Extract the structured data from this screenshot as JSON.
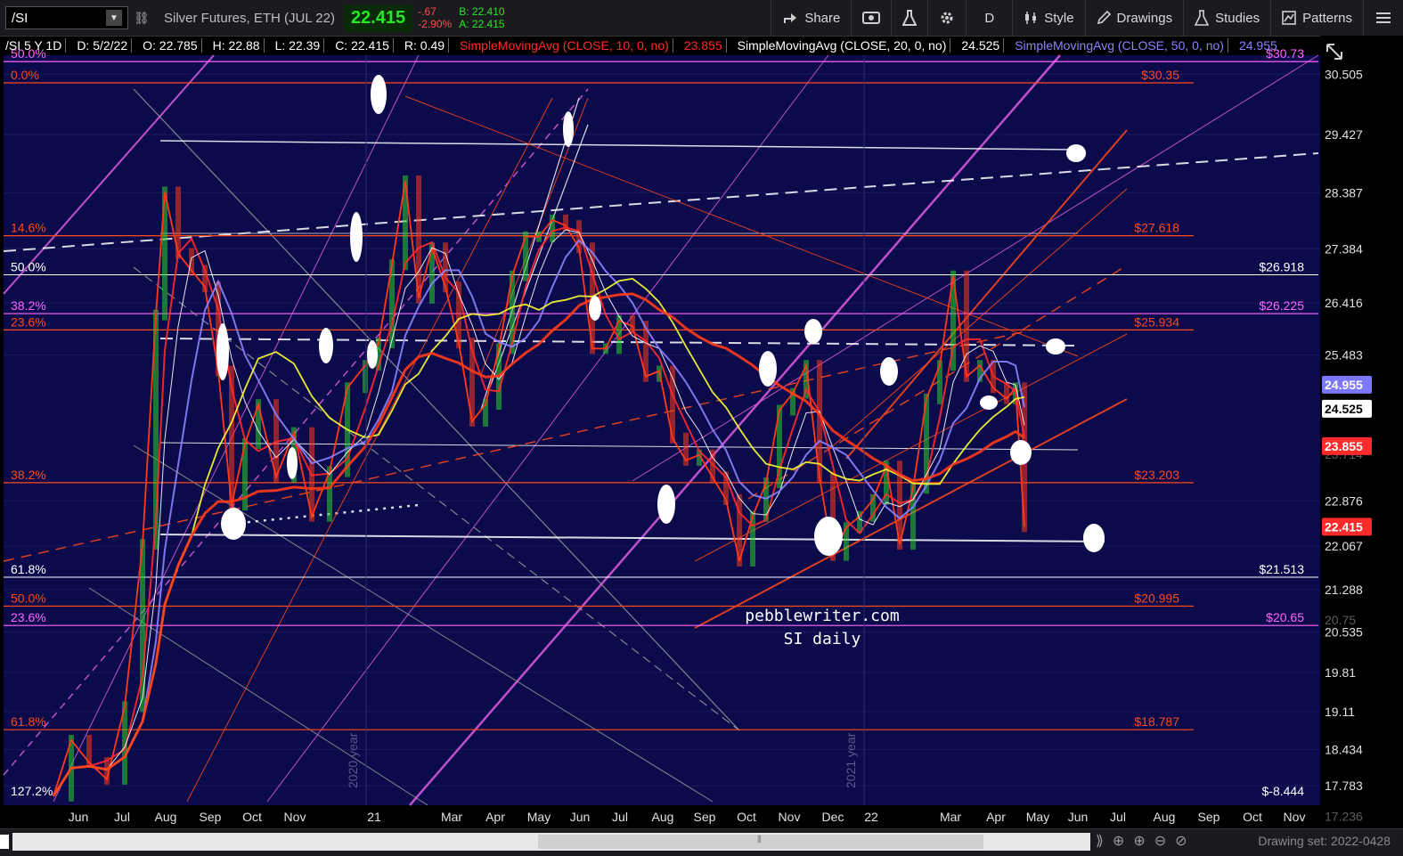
{
  "toolbar": {
    "symbol": "/SI",
    "description": "Silver Futures, ETH (JUL 22)",
    "last": "22.415",
    "change": "-.67",
    "change_pct": "-2.90%",
    "bid": "B: 22.410",
    "ask": "A: 22.415",
    "share": "Share",
    "period": "D",
    "style": "Style",
    "drawings": "Drawings",
    "studies": "Studies",
    "patterns": "Patterns"
  },
  "legend": {
    "header": "/SI 5 Y 1D",
    "date": "D: 5/2/22",
    "open": "O: 22.785",
    "high": "H: 22.88",
    "low": "L: 22.39",
    "close": "C: 22.415",
    "range": "R: 0.49",
    "sma10_label": "SimpleMovingAvg (CLOSE, 10, 0, no)",
    "sma10_value": "23.855",
    "sma20_label": "SimpleMovingAvg (CLOSE, 20, 0, no)",
    "sma20_value": "24.525",
    "sma50_label": "SimpleMovingAvg (CLOSE, 50, 0, no)",
    "sma50_value": "24.955"
  },
  "chart_data": {
    "type": "candlestick",
    "symbol": "/SI",
    "timeframe": "5 Y 1D",
    "ylim": [
      17.5,
      30.9
    ],
    "y_ticks": [
      30.505,
      29.427,
      28.387,
      27.384,
      26.416,
      25.483,
      22.876,
      22.067,
      21.288,
      20.535,
      19.81,
      19.11,
      18.434,
      17.783
    ],
    "x_ticks": [
      {
        "label": "Jun",
        "px": 88
      },
      {
        "label": "Jul",
        "px": 137
      },
      {
        "label": "Aug",
        "px": 186
      },
      {
        "label": "Sep",
        "px": 236
      },
      {
        "label": "Oct",
        "px": 283
      },
      {
        "label": "Nov",
        "px": 331
      },
      {
        "label": "21",
        "px": 420
      },
      {
        "label": "Mar",
        "px": 507
      },
      {
        "label": "Apr",
        "px": 556
      },
      {
        "label": "May",
        "px": 605
      },
      {
        "label": "Jun",
        "px": 651
      },
      {
        "label": "Jul",
        "px": 696
      },
      {
        "label": "Aug",
        "px": 744
      },
      {
        "label": "Sep",
        "px": 791
      },
      {
        "label": "Oct",
        "px": 838
      },
      {
        "label": "Nov",
        "px": 886
      },
      {
        "label": "Dec",
        "px": 935
      },
      {
        "label": "22",
        "px": 978
      },
      {
        "label": "Mar",
        "px": 1067
      },
      {
        "label": "Apr",
        "px": 1118
      },
      {
        "label": "May",
        "px": 1165
      },
      {
        "label": "Jun",
        "px": 1210
      },
      {
        "label": "Jul",
        "px": 1255
      },
      {
        "label": "Aug",
        "px": 1307
      },
      {
        "label": "Sep",
        "px": 1357
      },
      {
        "label": "Oct",
        "px": 1406
      },
      {
        "label": "Nov",
        "px": 1453
      }
    ],
    "year_markers": [
      {
        "label": "2020 year",
        "px": 401
      },
      {
        "label": "2021 year",
        "px": 960
      }
    ],
    "price_series": {
      "x": [
        60,
        80,
        100,
        120,
        140,
        160,
        175,
        185,
        200,
        215,
        230,
        245,
        260,
        275,
        290,
        310,
        330,
        350,
        370,
        390,
        410,
        425,
        440,
        455,
        470,
        485,
        500,
        515,
        530,
        545,
        560,
        575,
        590,
        605,
        620,
        635,
        650,
        665,
        680,
        695,
        710,
        725,
        740,
        755,
        770,
        785,
        800,
        815,
        830,
        845,
        860,
        875,
        890,
        905,
        920,
        935,
        950,
        965,
        980,
        995,
        1010,
        1025,
        1040,
        1055,
        1070,
        1085,
        1100,
        1115,
        1130,
        1140,
        1150
      ],
      "y": [
        17.6,
        18.6,
        18.2,
        17.9,
        19.2,
        22.1,
        26.2,
        28.4,
        27.3,
        27.0,
        26.7,
        25.2,
        22.8,
        23.9,
        24.6,
        23.3,
        24.1,
        22.6,
        23.4,
        24.9,
        25.3,
        25.7,
        27.1,
        28.6,
        26.5,
        27.4,
        26.7,
        25.7,
        24.3,
        24.6,
        25.6,
        26.9,
        27.6,
        27.6,
        27.9,
        27.8,
        27.4,
        25.6,
        25.6,
        26.1,
        26.0,
        25.1,
        25.2,
        24.0,
        23.6,
        23.7,
        23.3,
        22.9,
        21.8,
        22.6,
        23.2,
        24.5,
        24.8,
        25.3,
        23.3,
        21.9,
        22.4,
        22.6,
        22.9,
        23.5,
        22.1,
        23.1,
        24.7,
        25.3,
        26.9,
        25.1,
        25.3,
        24.9,
        24.7,
        24.9,
        22.415
      ]
    },
    "moving_averages": [
      {
        "name": "SimpleMovingAvg (CLOSE, 10, 0, no)",
        "color": "#ff2a2a",
        "value": 23.855
      },
      {
        "name": "SimpleMovingAvg (CLOSE, 20, 0, no)",
        "color": "#ffffff",
        "value": 24.525
      },
      {
        "name": "SimpleMovingAvg (CLOSE, 50, 0, no)",
        "color": "#8a83ff",
        "value": 24.955
      }
    ],
    "fib_levels": [
      {
        "label": "50.0%",
        "value": "$30.73",
        "color": "#ff66ff"
      },
      {
        "label": "0.0%",
        "value": "$30.35",
        "color": "#ff4a1a"
      },
      {
        "label": "14.6%",
        "value": "$27.618",
        "color": "#ff4a1a"
      },
      {
        "label": "50.0%",
        "value": "$26.918",
        "color": "#ffffff"
      },
      {
        "label": "38.2%",
        "value": "$26.225",
        "color": "#ff66ff"
      },
      {
        "label": "23.6%",
        "value": "$25.934",
        "color": "#ff4a1a"
      },
      {
        "label": "38.2%",
        "value": "$23.203",
        "color": "#ff4a1a"
      },
      {
        "label": "61.8%",
        "value": "$21.513",
        "color": "#ffffff"
      },
      {
        "label": "50.0%",
        "value": "$20.995",
        "color": "#ff4a1a"
      },
      {
        "label": "23.6%",
        "value": "$20.65",
        "color": "#ff66ff"
      },
      {
        "label": "61.8%",
        "value": "$18.787",
        "color": "#ff4a1a"
      },
      {
        "label": "127.2%",
        "value": "$-8.444",
        "color": "#ffffff"
      }
    ],
    "price_badges": [
      {
        "value": "24.955",
        "bg": "#7b78ff",
        "fg": "#ffffff"
      },
      {
        "value": "24.525",
        "bg": "#ffffff",
        "fg": "#000000"
      },
      {
        "value": "23.855",
        "bg": "#ff2a2a",
        "fg": "#ffffff"
      },
      {
        "value": "22.415",
        "bg": "#ff2a2a",
        "fg": "#ffffff"
      }
    ],
    "hidden_ticks": [
      "23.714",
      "17.236",
      "20.75"
    ],
    "annotation": "pebblewriter.com\nSI daily"
  },
  "footer": {
    "drawing_set": "Drawing set: 2022-0428"
  }
}
